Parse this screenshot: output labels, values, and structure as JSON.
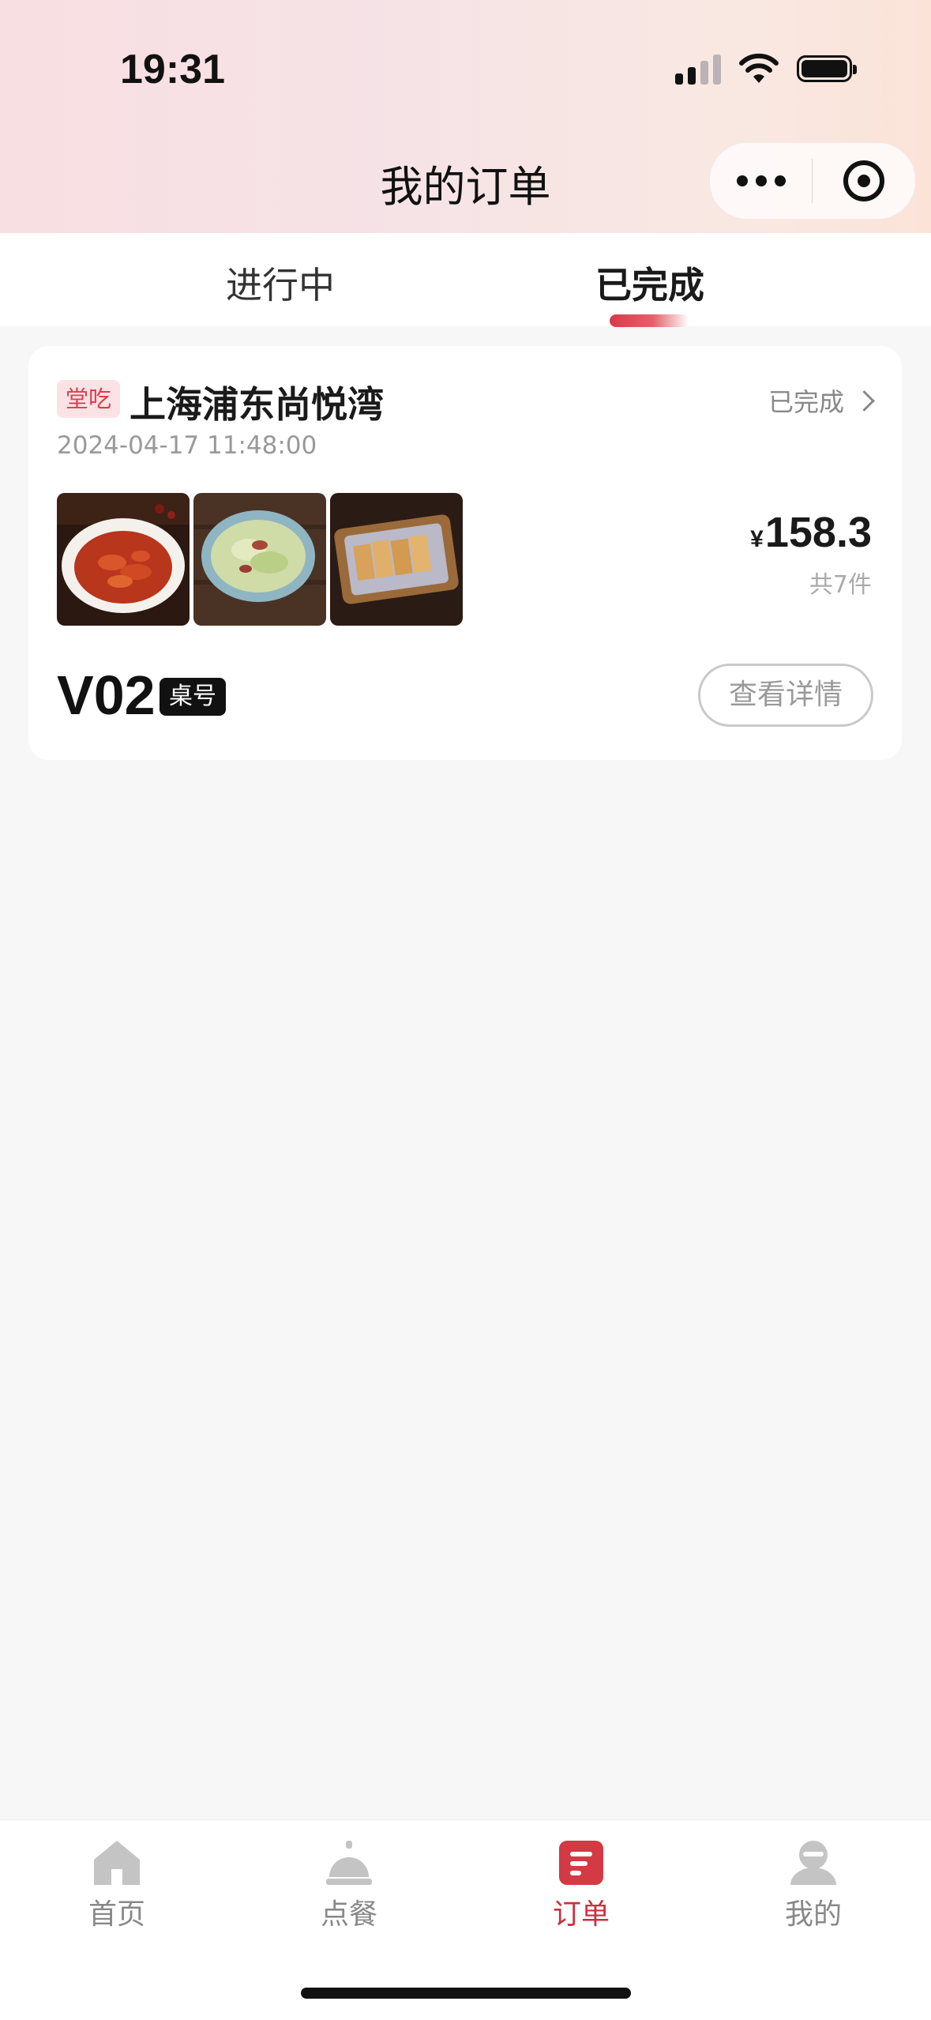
{
  "status_bar": {
    "time": "19:31"
  },
  "header": {
    "title": "我的订单",
    "more_icon": "more-dots-icon",
    "close_icon": "target-circle-icon"
  },
  "tabs": [
    {
      "label": "进行中",
      "active": false
    },
    {
      "label": "已完成",
      "active": true
    }
  ],
  "colors": {
    "accent": "#d93a48",
    "badge_bg": "#fbe3e5"
  },
  "order": {
    "badge": "堂吃",
    "store": "上海浦东尚悦湾",
    "status": "已完成",
    "time": "2024-04-17 11:48:00",
    "currency": "¥",
    "price": "158.3",
    "count": "共7件",
    "table_no": "V02",
    "table_tag": "桌号",
    "detail_button": "查看详情",
    "dishes": [
      "dish-crayfish-image",
      "dish-cabbage-image",
      "dish-fried-snack-image"
    ]
  },
  "tabbar": [
    {
      "label": "首页",
      "icon": "home-icon",
      "active": false
    },
    {
      "label": "点餐",
      "icon": "service-bell-icon",
      "active": false
    },
    {
      "label": "订单",
      "icon": "order-doc-icon",
      "active": true
    },
    {
      "label": "我的",
      "icon": "user-icon",
      "active": false
    }
  ]
}
